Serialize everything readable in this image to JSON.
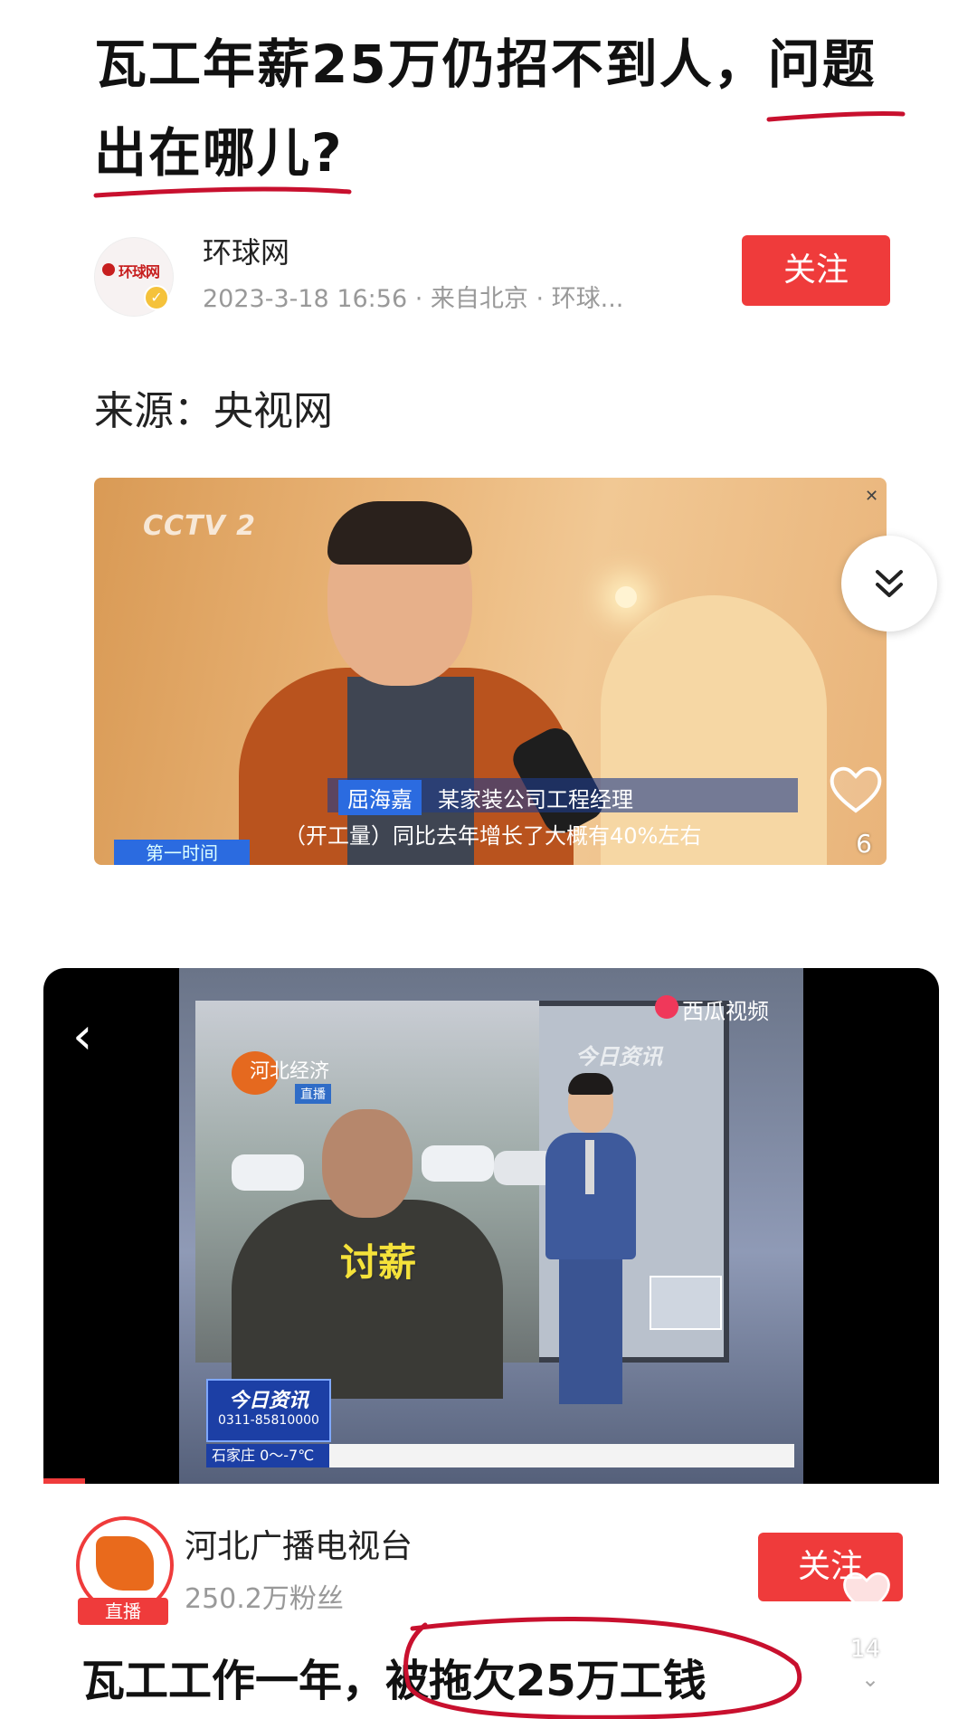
{
  "article": {
    "title_line1": "瓦工年薪25万仍招不到人，问题",
    "title_line2": "出在哪儿?",
    "author": {
      "name": "环球网",
      "meta": "2023-3-18 16:56 · 来自北京 · 环球...",
      "follow_label": "关注",
      "avatar_text": "环球网"
    },
    "source": "来源：央视网"
  },
  "video1": {
    "channel_logo": "CCTV 2",
    "name_tag": "屈海嘉",
    "role": "某家装公司工程经理",
    "subtitle": "（开工量）同比去年增长了大概有40%左右",
    "program_tag": "第一时间",
    "like_count": "6"
  },
  "post2": {
    "video": {
      "watermark": "西瓜视频",
      "station": "河北经济",
      "live_tag": "直播",
      "program": "今日资讯",
      "worker_caption": "讨薪",
      "ticker_title": "今日资讯",
      "ticker_phone": "0311-85810000",
      "ticker_city": "石家庄  0～-7℃"
    },
    "author": {
      "name": "河北广播电视台",
      "fans": "250.2万粉丝",
      "live_badge": "直播",
      "follow_label": "关注"
    },
    "like_count": "14",
    "headline": "瓦工工作一年，被拖欠25万工钱"
  },
  "colors": {
    "accent_red": "#ef3b3b",
    "ink_red": "#c8102e",
    "meta_gray": "#999999"
  },
  "icons": [
    "close-icon",
    "chevron-double-down-icon",
    "heart-icon",
    "back-arrow-icon",
    "chevron-down-icon",
    "verified-icon"
  ]
}
